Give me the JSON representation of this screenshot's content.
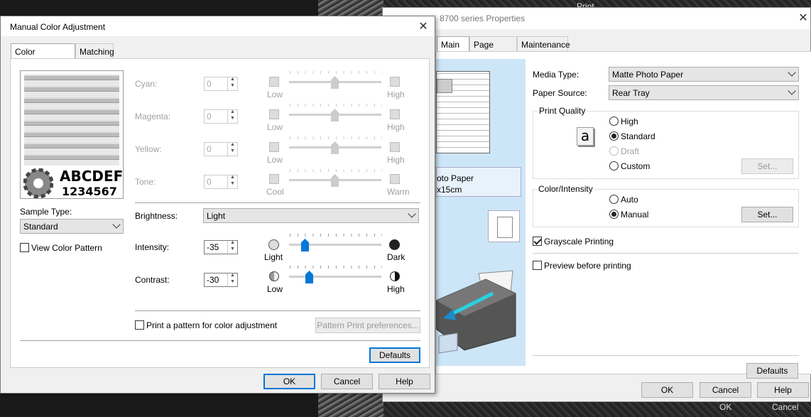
{
  "background": {
    "print_title": "Print",
    "ok": "OK",
    "cancel": "Cancel"
  },
  "props": {
    "title": "8700 series Properties",
    "tabs": [
      "Main",
      "Page Setup",
      "Maintenance"
    ],
    "preview_text": [
      "oto Paper",
      "x15cm"
    ],
    "media_type_label": "Media Type:",
    "media_type": "Matte Photo Paper",
    "paper_source_label": "Paper Source:",
    "paper_source": "Rear Tray",
    "print_quality": {
      "title": "Print Quality",
      "options": [
        "High",
        "Standard",
        "Draft",
        "Custom"
      ],
      "selected": "Standard",
      "set_label": "Set..."
    },
    "color_intensity": {
      "title": "Color/Intensity",
      "options": [
        "Auto",
        "Manual"
      ],
      "selected": "Manual",
      "set_label": "Set..."
    },
    "grayscale_label": "Grayscale Printing",
    "grayscale": true,
    "preview_label": "Preview before printing",
    "preview": false,
    "defaults_label": "Defaults",
    "ok": "OK",
    "cancel": "Cancel",
    "help": "Help"
  },
  "mca": {
    "title": "Manual Color Adjustment",
    "tabs": [
      "Color Adjustment",
      "Matching"
    ],
    "sample_letters": "ABCDEF",
    "sample_digits": "1234567",
    "sample_type_label": "Sample Type:",
    "sample_type": "Standard",
    "view_pattern_label": "View Color Pattern",
    "sliders": [
      {
        "label": "Cyan:",
        "value": "0",
        "low": "Low",
        "high": "High"
      },
      {
        "label": "Magenta:",
        "value": "0",
        "low": "Low",
        "high": "High"
      },
      {
        "label": "Yellow:",
        "value": "0",
        "low": "Low",
        "high": "High"
      },
      {
        "label": "Tone:",
        "value": "0",
        "low": "Cool",
        "high": "Warm"
      }
    ],
    "brightness_label": "Brightness:",
    "brightness": "Light",
    "intensity_label": "Intensity:",
    "intensity": "-35",
    "intensity_low": "Light",
    "intensity_high": "Dark",
    "contrast_label": "Contrast:",
    "contrast": "-30",
    "contrast_low": "Low",
    "contrast_high": "High",
    "print_pattern_label": "Print a pattern for color adjustment",
    "pattern_prefs_label": "Pattern Print preferences...",
    "defaults_label": "Defaults",
    "ok": "OK",
    "cancel": "Cancel",
    "help": "Help"
  }
}
